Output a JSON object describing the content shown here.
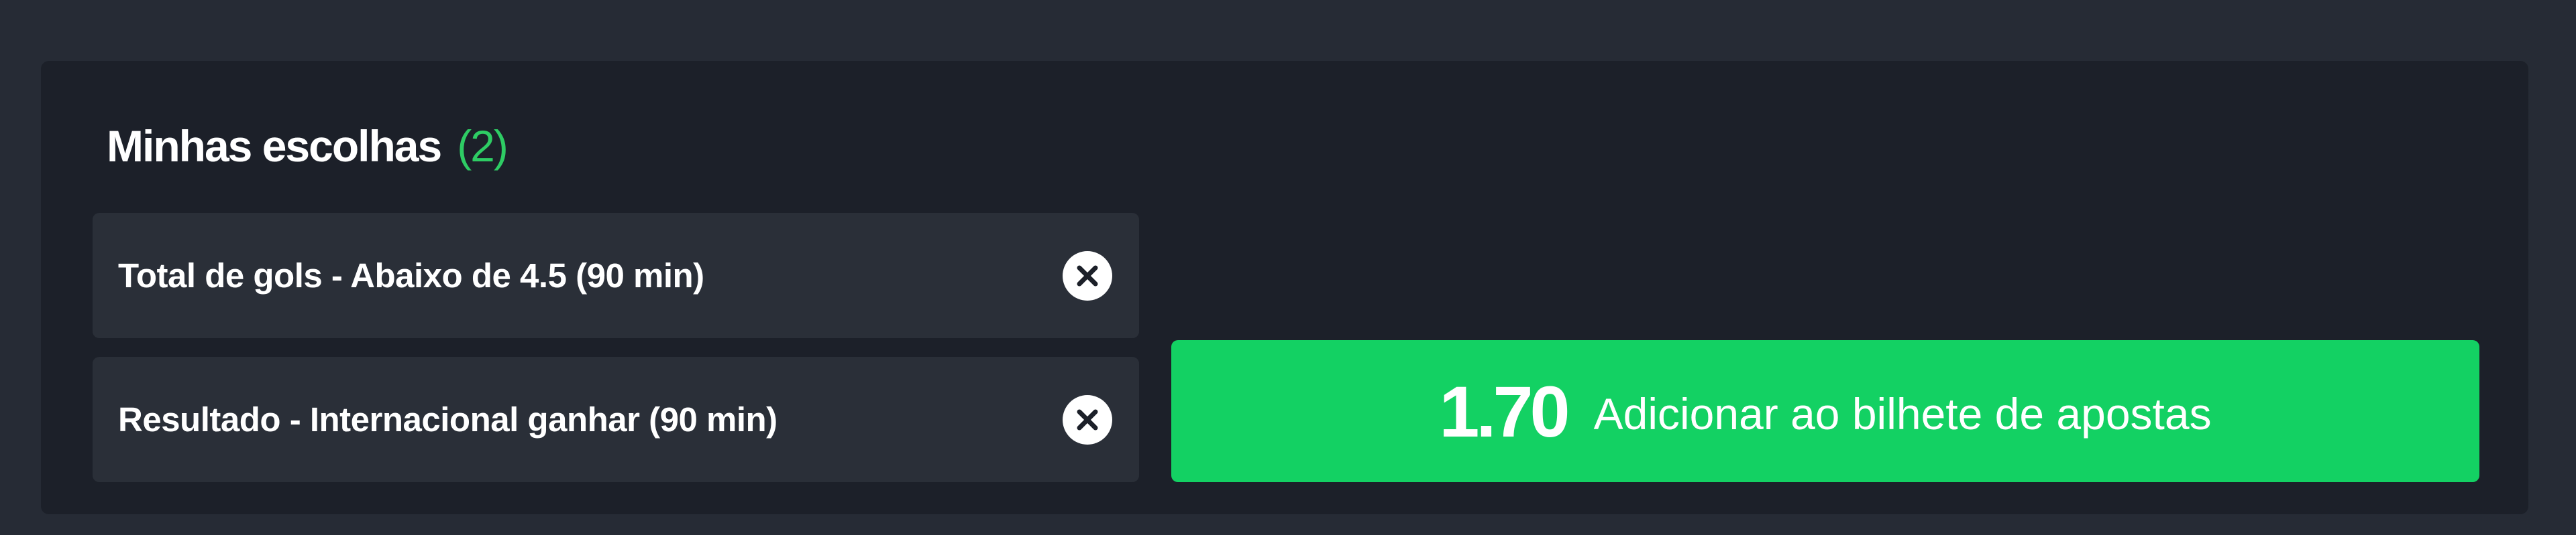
{
  "selections_panel": {
    "title": "Minhas escolhas",
    "count": "(2)",
    "selections": [
      {
        "label": "Total de gols - Abaixo de 4.5 (90 min)",
        "remove_icon": "close-circle-icon"
      },
      {
        "label": "Resultado - Internacional ganhar (90 min)",
        "remove_icon": "close-circle-icon"
      }
    ],
    "add_button": {
      "odds": "1.70",
      "label": "Adicionar ao bilhete de apostas"
    }
  },
  "colors": {
    "page_background": "#262b35",
    "panel_background": "#1c2029",
    "selection_background": "#2a2f38",
    "accent_green": "#13d163",
    "count_green": "#2ecc64",
    "text": "#ffffff"
  }
}
